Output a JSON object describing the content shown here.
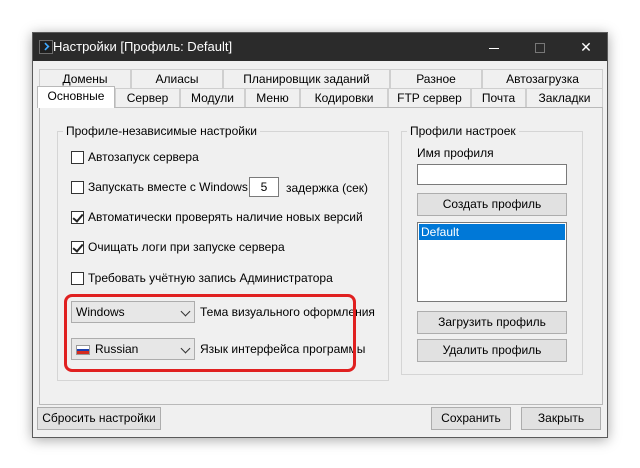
{
  "window": {
    "title": "Настройки [Профиль: Default]"
  },
  "tabs_row1": [
    "Домены",
    "Алиасы",
    "Планировщик заданий",
    "Разное",
    "Автозагрузка"
  ],
  "tabs_row2": [
    "Основные",
    "Сервер",
    "Модули",
    "Меню",
    "Кодировки",
    "FTP сервер",
    "Почта",
    "Закладки"
  ],
  "active_tab": "Основные",
  "general": {
    "group_title": "Профиле-независимые настройки",
    "checkboxes": [
      {
        "label": "Автозапуск сервера",
        "checked": false
      },
      {
        "label": "Запускать вместе с Windows",
        "checked": false
      },
      {
        "label": "Автоматически проверять наличие новых версий",
        "checked": true
      },
      {
        "label": "Очищать логи при запуске сервера",
        "checked": true
      },
      {
        "label": "Требовать учётную запись Администратора",
        "checked": false
      }
    ],
    "delay_value": "5",
    "delay_label": "задержка (сек)",
    "theme_value": "Windows",
    "theme_label": "Тема визуального оформления",
    "language_value": "Russian",
    "language_label": "Язык интерфейса программы",
    "highlight_color": "#e02020"
  },
  "profiles": {
    "group_title": "Профили настроек",
    "name_label": "Имя профиля",
    "name_value": "",
    "create_button": "Создать профиль",
    "list": [
      "Default"
    ],
    "load_button": "Загрузить профиль",
    "delete_button": "Удалить профиль"
  },
  "footer": {
    "reset_button": "Сбросить настройки",
    "save_button": "Сохранить",
    "close_button": "Закрыть"
  },
  "colors": {
    "titlebar_bg": "#2b2b2b",
    "selection": "#0078d7"
  }
}
